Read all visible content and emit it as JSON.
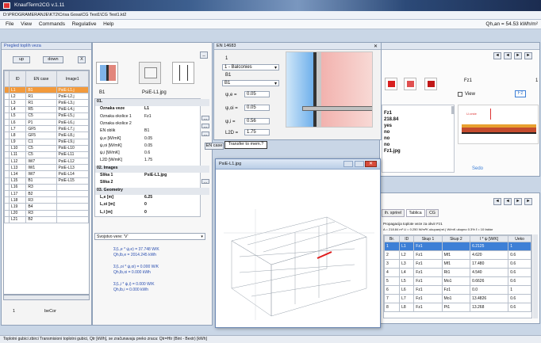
{
  "window": {
    "title": "KnaufTerm2CG v.1.11",
    "path": "D:\\PROGRAMERANJE\\KT2\\Crisa Gosa\\CG Test1\\CG Test1.kt2"
  },
  "menu": [
    "File",
    "View",
    "Commands",
    "Regulative",
    "Help"
  ],
  "qh": "Qh,an = 54.53 kWh/m²",
  "left": {
    "title": "Pregled toplih veza",
    "btn_up": "up",
    "btn_down": "down",
    "btn_x": "X",
    "headers": [
      "ID",
      "EN case",
      "Image1"
    ],
    "rows": [
      [
        "L1",
        "B1",
        "PsiE-L1.j"
      ],
      [
        "L2",
        "R1",
        "PsiE-L2.j"
      ],
      [
        "L3",
        "R1",
        "PsiE-L3.j"
      ],
      [
        "L4",
        "R5",
        "PsiE-L4.j"
      ],
      [
        "L5",
        "C5",
        "PsiE-L5.j"
      ],
      [
        "L6",
        "P1",
        "PsiE-L6.j"
      ],
      [
        "L7",
        "GF5",
        "PsiE-L7.j"
      ],
      [
        "L8",
        "GF5",
        "PsiE-L8.j"
      ],
      [
        "L9",
        "C1",
        "PsiE-L9.j"
      ],
      [
        "L10",
        "C5",
        "PsiE-L10"
      ],
      [
        "L11",
        "C5",
        "PsiE-L11"
      ],
      [
        "L12",
        "IW7",
        "PsiE-L12"
      ],
      [
        "L13",
        "IW1",
        "PsiE-L13"
      ],
      [
        "L14",
        "IW7",
        "PsiE-L14"
      ],
      [
        "L15",
        "B1",
        "PsiE-L15"
      ],
      [
        "L16",
        "R3",
        ""
      ],
      [
        "L17",
        "B2",
        ""
      ],
      [
        "L18",
        "R3",
        ""
      ],
      [
        "L19",
        "B4",
        ""
      ],
      [
        "L20",
        "R3",
        ""
      ],
      [
        "L21",
        "B2",
        ""
      ]
    ],
    "footer_num": "1",
    "footer_label": "beCor"
  },
  "prop": {
    "img1_label": "B1",
    "img2_label": "PsiE-L1.jpg",
    "rows": [
      {
        "k": "01.",
        "v": "",
        "hd": true
      },
      {
        "k": "Oznaka veze",
        "v": "L1",
        "bold": true
      },
      {
        "k": "Oznaka okolice 1",
        "v": "Fz1"
      },
      {
        "k": "Oznaka okolice 2",
        "v": ""
      },
      {
        "k": "EN oblik",
        "v": "B1"
      },
      {
        "k": "ψ,e [W/mK]",
        "v": "0.05"
      },
      {
        "k": "ψ,oi [W/mK]",
        "v": "0.05"
      },
      {
        "k": "ψ,i [W/mK]",
        "v": "0.6"
      },
      {
        "k": "L2D [W/mK]",
        "v": "1.75"
      },
      {
        "k": "02. Images",
        "v": "",
        "hd": true
      },
      {
        "k": "Slika 1",
        "v": "PsiE-L1.jpg",
        "bold": true
      },
      {
        "k": "Slika 2",
        "v": "",
        "bold": true
      },
      {
        "k": "03. Geometry",
        "v": "",
        "hd": true
      },
      {
        "k": "L,e [m]",
        "v": "6.25",
        "bold": true
      },
      {
        "k": "L,oi [m]",
        "v": "0",
        "bold": true
      },
      {
        "k": "L,i [m]",
        "v": "0",
        "bold": true
      }
    ],
    "dropdown": "Svojstvo vere: 'V'",
    "calc": [
      "Σ(L,e * ψ,e) = 37.748 W/K",
      "Qh,lb,e = 2014.245 kWh",
      "Σ(L,oi * ψ,oi) = 0.000 W/K",
      "Qh,lb,oi = 0.000 kWh",
      "Σ(L,i * ψ,i) = 0.000 W/K",
      "Qh,lb,i = 0.000 kWh"
    ]
  },
  "en": {
    "title": "EN 14683",
    "field1": "1",
    "dropdown": "1 - Balconies",
    "dropdown2": "B1",
    "combo": "B1",
    "labels": [
      "ψ,e =",
      "ψ,oi =",
      "ψ,i =",
      "L2D ="
    ],
    "values": [
      "0.05",
      "0.05",
      "0.56",
      "1.75"
    ],
    "transfer_btn": "Transfer to mem.?",
    "en_case_btn": "EN case"
  },
  "popup": {
    "title": "PsiE-L1.jpg"
  },
  "rightTop": {
    "nav": [
      "◄",
      "◄",
      "►",
      "►"
    ],
    "dropdown": "Fz1",
    "num": "1",
    "view_label": "View",
    "fz": "Fz",
    "rows": [
      "Fz1",
      "218.84",
      "yes",
      "no",
      "no",
      "no",
      "Fz1.jpg"
    ],
    "swatch_label": "Sedo"
  },
  "rightBottom": {
    "tabs": [
      "ih. sprirel",
      "Tablica",
      "CG"
    ],
    "info1": "Propagacija toplote veze za okvir      Fz1",
    "info2": "A = 218.84 m²   U = 0.250 W/m²K   ukupan(rel.) W/mK ukupno 0.3%   ℓ = 10 faktor",
    "headers": [
      "Br.",
      "ID",
      "Skup 1",
      "Skup 2",
      "l * ψ [W/K]",
      "Ueko"
    ],
    "rows": [
      [
        "1",
        "L1",
        "Fz1",
        "",
        "6.2125",
        "1"
      ],
      [
        "2",
        "L2",
        "Fz1",
        "Mf1",
        "4.620",
        "0.6"
      ],
      [
        "3",
        "L3",
        "Fz1",
        "Mf1",
        "17.480",
        "0.6"
      ],
      [
        "4",
        "L4",
        "Fz1",
        "Rt1",
        "4.540",
        "0.6"
      ],
      [
        "5",
        "L5",
        "Fz1",
        "Mo1",
        "0.6626",
        "0.6"
      ],
      [
        "6",
        "L6",
        "Fz1",
        "Fz1",
        "0.0",
        "1"
      ],
      [
        "7",
        "L7",
        "Fz1",
        "Mo1",
        "13.4826",
        "0.6"
      ],
      [
        "8",
        "L8",
        "Fz1",
        "Pt1",
        "13.268",
        "0.6"
      ]
    ],
    "nav": [
      "◄",
      "◄",
      "►",
      "►"
    ]
  },
  "status": "Toplotni gubici zbirci   Transmisioni toplotni gubici, Qtr [kWh], se zračunavaju preko zraca: Qtr=Htr (Bint - Bextr) [kWh]",
  "colors": {
    "accent": "#3d7fd6",
    "selected": "#f29a3c",
    "title": "#1d2f57"
  }
}
